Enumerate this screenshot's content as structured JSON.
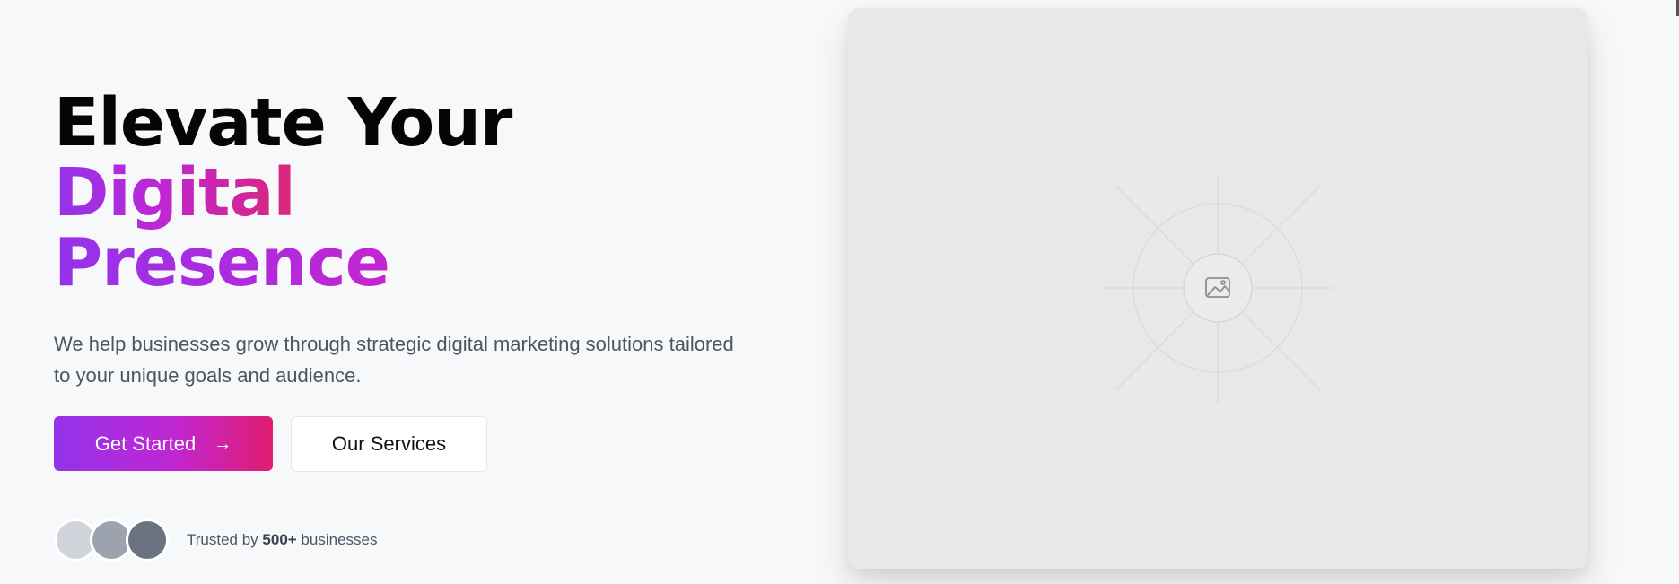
{
  "hero": {
    "headline_part1": "Elevate Your ",
    "headline_highlight1": "Digital",
    "headline_highlight2": "Presence",
    "description": "We help businesses grow through strategic digital marketing solutions tailored to your unique goals and audience.",
    "primary_button": {
      "label": "Get Started",
      "icon": "arrow-right-icon"
    },
    "secondary_button": {
      "label": "Our Services"
    },
    "trust": {
      "prefix": "Trusted by ",
      "count": "500+",
      "suffix": " businesses"
    }
  },
  "media": {
    "icon": "image-icon"
  },
  "colors": {
    "page_background": "#f7f8fa",
    "gradient_start": "#9333ea",
    "gradient_end": "#db2777",
    "body_text": "#4b5563",
    "placeholder_bg": "#e8e8e8"
  }
}
